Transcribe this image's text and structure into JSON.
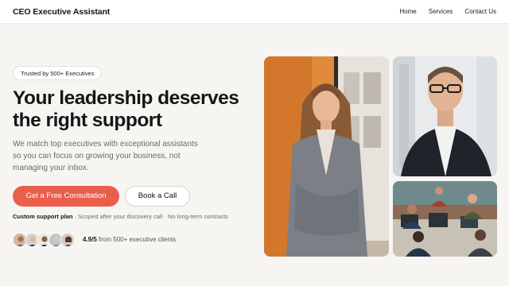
{
  "header": {
    "brand": "CEO Executive Assistant",
    "nav": [
      "Home",
      "Services",
      "Contact Us"
    ]
  },
  "hero": {
    "badge": "Trusted by 500+ Executives",
    "headline_line1": "Your leadership deserves",
    "headline_line2": "the right support",
    "subtext": "We match top executives with exceptional assistants so you can focus on growing your business, not managing your inbox.",
    "primary_cta": "Get a Free Consultation",
    "secondary_cta": "Book a Call",
    "meta_strong": "Custom support plan",
    "meta_rest": " · Scoped after your discovery call · No long-term contracts",
    "rating_value": "4.9/5",
    "rating_rest": " from 500+ executive clients"
  },
  "colors": {
    "accent": "#ec5e4c",
    "background": "#f7f5f2"
  },
  "images": [
    {
      "name": "woman-executive-photo"
    },
    {
      "name": "man-executive-photo"
    },
    {
      "name": "office-team-photo"
    }
  ]
}
